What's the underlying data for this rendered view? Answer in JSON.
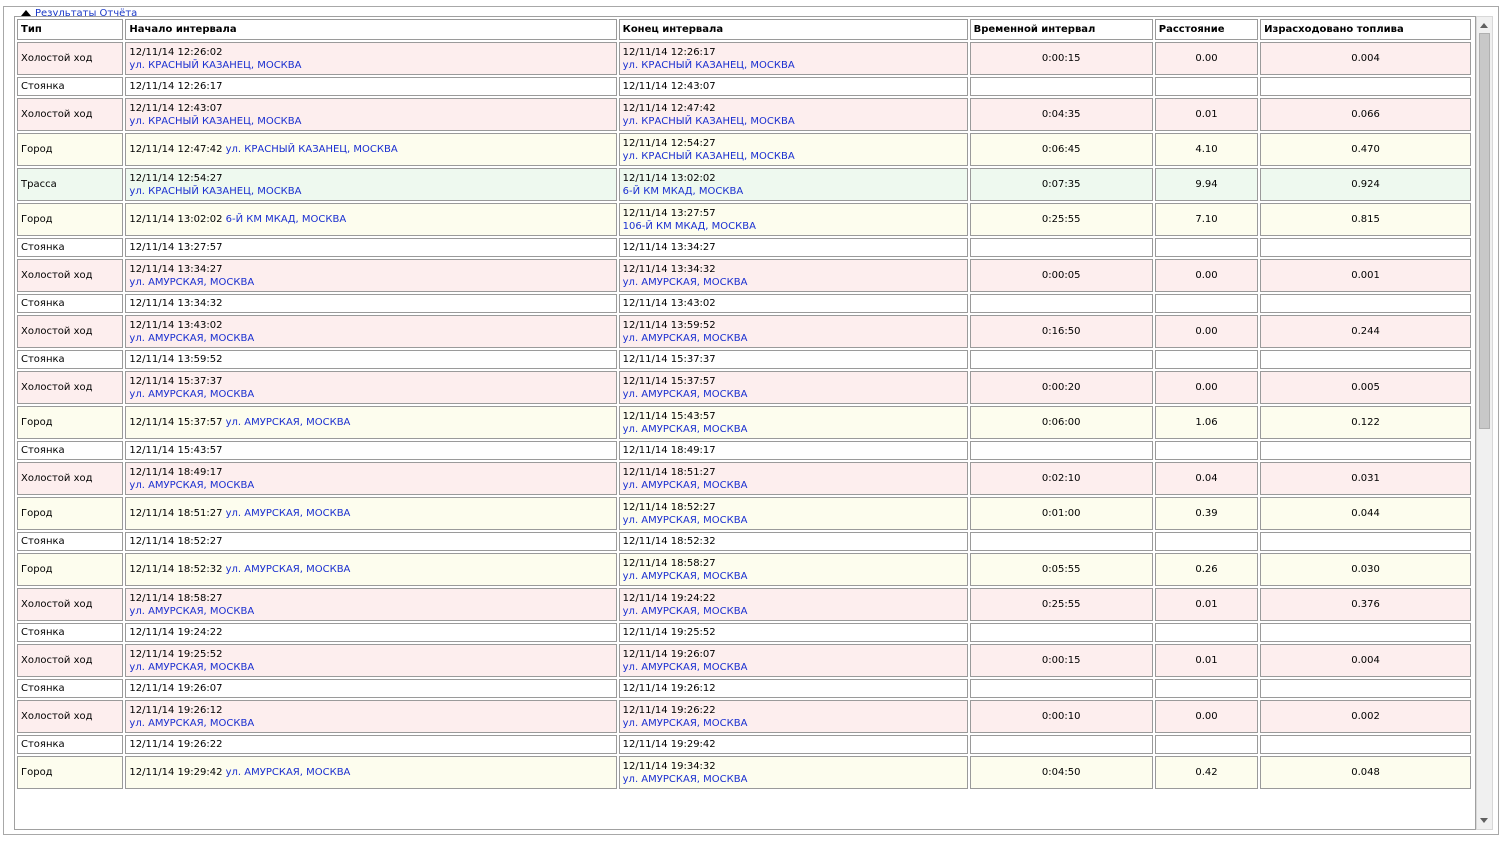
{
  "panel": {
    "title": "Результаты Отчёта"
  },
  "columns": [
    "Тип",
    "Начало интервала",
    "Конец интервала",
    "Временной интервал",
    "Расстояние",
    "Израсходовано топлива"
  ],
  "rows": [
    {
      "kind": "idle",
      "type": "Холостой ход",
      "start_time": "12/11/14 12:26:02",
      "start_addr": "ул. КРАСНЫЙ КАЗАНЕЦ, МОСКВА",
      "start_inline": false,
      "end_time": "12/11/14 12:26:17",
      "end_addr": "ул. КРАСНЫЙ КАЗАНЕЦ, МОСКВА",
      "duration": "0:00:15",
      "distance": "0.00",
      "fuel": "0.004"
    },
    {
      "kind": "parking",
      "type": "Стоянка",
      "start_time": "12/11/14 12:26:17",
      "start_addr": "",
      "start_inline": false,
      "end_time": "12/11/14 12:43:07",
      "end_addr": "",
      "duration": "",
      "distance": "",
      "fuel": ""
    },
    {
      "kind": "idle",
      "type": "Холостой ход",
      "start_time": "12/11/14 12:43:07",
      "start_addr": "ул. КРАСНЫЙ КАЗАНЕЦ, МОСКВА",
      "start_inline": false,
      "end_time": "12/11/14 12:47:42",
      "end_addr": "ул. КРАСНЫЙ КАЗАНЕЦ, МОСКВА",
      "duration": "0:04:35",
      "distance": "0.01",
      "fuel": "0.066"
    },
    {
      "kind": "city",
      "type": "Город",
      "start_time": "12/11/14 12:47:42",
      "start_addr": "ул. КРАСНЫЙ КАЗАНЕЦ, МОСКВА",
      "start_inline": true,
      "end_time": "12/11/14 12:54:27",
      "end_addr": "ул. КРАСНЫЙ КАЗАНЕЦ, МОСКВА",
      "duration": "0:06:45",
      "distance": "4.10",
      "fuel": "0.470"
    },
    {
      "kind": "highway",
      "type": "Трасса",
      "start_time": "12/11/14 12:54:27",
      "start_addr": "ул. КРАСНЫЙ КАЗАНЕЦ, МОСКВА",
      "start_inline": false,
      "end_time": "12/11/14 13:02:02",
      "end_addr": "6-Й КМ МКАД, МОСКВА",
      "duration": "0:07:35",
      "distance": "9.94",
      "fuel": "0.924"
    },
    {
      "kind": "city",
      "type": "Город",
      "start_time": "12/11/14 13:02:02",
      "start_addr": "6-Й КМ МКАД, МОСКВА",
      "start_inline": true,
      "end_time": "12/11/14 13:27:57",
      "end_addr": "106-Й КМ МКАД, МОСКВА",
      "duration": "0:25:55",
      "distance": "7.10",
      "fuel": "0.815"
    },
    {
      "kind": "parking",
      "type": "Стоянка",
      "start_time": "12/11/14 13:27:57",
      "start_addr": "",
      "start_inline": false,
      "end_time": "12/11/14 13:34:27",
      "end_addr": "",
      "duration": "",
      "distance": "",
      "fuel": ""
    },
    {
      "kind": "idle",
      "type": "Холостой ход",
      "start_time": "12/11/14 13:34:27",
      "start_addr": "ул. АМУРСКАЯ, МОСКВА",
      "start_inline": false,
      "end_time": "12/11/14 13:34:32",
      "end_addr": "ул. АМУРСКАЯ, МОСКВА",
      "duration": "0:00:05",
      "distance": "0.00",
      "fuel": "0.001"
    },
    {
      "kind": "parking",
      "type": "Стоянка",
      "start_time": "12/11/14 13:34:32",
      "start_addr": "",
      "start_inline": false,
      "end_time": "12/11/14 13:43:02",
      "end_addr": "",
      "duration": "",
      "distance": "",
      "fuel": ""
    },
    {
      "kind": "idle",
      "type": "Холостой ход",
      "start_time": "12/11/14 13:43:02",
      "start_addr": "ул. АМУРСКАЯ, МОСКВА",
      "start_inline": false,
      "end_time": "12/11/14 13:59:52",
      "end_addr": "ул. АМУРСКАЯ, МОСКВА",
      "duration": "0:16:50",
      "distance": "0.00",
      "fuel": "0.244"
    },
    {
      "kind": "parking",
      "type": "Стоянка",
      "start_time": "12/11/14 13:59:52",
      "start_addr": "",
      "start_inline": false,
      "end_time": "12/11/14 15:37:37",
      "end_addr": "",
      "duration": "",
      "distance": "",
      "fuel": ""
    },
    {
      "kind": "idle",
      "type": "Холостой ход",
      "start_time": "12/11/14 15:37:37",
      "start_addr": "ул. АМУРСКАЯ, МОСКВА",
      "start_inline": false,
      "end_time": "12/11/14 15:37:57",
      "end_addr": "ул. АМУРСКАЯ, МОСКВА",
      "duration": "0:00:20",
      "distance": "0.00",
      "fuel": "0.005"
    },
    {
      "kind": "city",
      "type": "Город",
      "start_time": "12/11/14 15:37:57",
      "start_addr": "ул. АМУРСКАЯ, МОСКВА",
      "start_inline": true,
      "end_time": "12/11/14 15:43:57",
      "end_addr": "ул. АМУРСКАЯ, МОСКВА",
      "duration": "0:06:00",
      "distance": "1.06",
      "fuel": "0.122"
    },
    {
      "kind": "parking",
      "type": "Стоянка",
      "start_time": "12/11/14 15:43:57",
      "start_addr": "",
      "start_inline": false,
      "end_time": "12/11/14 18:49:17",
      "end_addr": "",
      "duration": "",
      "distance": "",
      "fuel": ""
    },
    {
      "kind": "idle",
      "type": "Холостой ход",
      "start_time": "12/11/14 18:49:17",
      "start_addr": "ул. АМУРСКАЯ, МОСКВА",
      "start_inline": false,
      "end_time": "12/11/14 18:51:27",
      "end_addr": "ул. АМУРСКАЯ, МОСКВА",
      "duration": "0:02:10",
      "distance": "0.04",
      "fuel": "0.031"
    },
    {
      "kind": "city",
      "type": "Город",
      "start_time": "12/11/14 18:51:27",
      "start_addr": "ул. АМУРСКАЯ, МОСКВА",
      "start_inline": true,
      "end_time": "12/11/14 18:52:27",
      "end_addr": "ул. АМУРСКАЯ, МОСКВА",
      "duration": "0:01:00",
      "distance": "0.39",
      "fuel": "0.044"
    },
    {
      "kind": "parking",
      "type": "Стоянка",
      "start_time": "12/11/14 18:52:27",
      "start_addr": "",
      "start_inline": false,
      "end_time": "12/11/14 18:52:32",
      "end_addr": "",
      "duration": "",
      "distance": "",
      "fuel": ""
    },
    {
      "kind": "city",
      "type": "Город",
      "start_time": "12/11/14 18:52:32",
      "start_addr": "ул. АМУРСКАЯ, МОСКВА",
      "start_inline": true,
      "end_time": "12/11/14 18:58:27",
      "end_addr": "ул. АМУРСКАЯ, МОСКВА",
      "duration": "0:05:55",
      "distance": "0.26",
      "fuel": "0.030"
    },
    {
      "kind": "idle",
      "type": "Холостой ход",
      "start_time": "12/11/14 18:58:27",
      "start_addr": "ул. АМУРСКАЯ, МОСКВА",
      "start_inline": false,
      "end_time": "12/11/14 19:24:22",
      "end_addr": "ул. АМУРСКАЯ, МОСКВА",
      "duration": "0:25:55",
      "distance": "0.01",
      "fuel": "0.376"
    },
    {
      "kind": "parking",
      "type": "Стоянка",
      "start_time": "12/11/14 19:24:22",
      "start_addr": "",
      "start_inline": false,
      "end_time": "12/11/14 19:25:52",
      "end_addr": "",
      "duration": "",
      "distance": "",
      "fuel": ""
    },
    {
      "kind": "idle",
      "type": "Холостой ход",
      "start_time": "12/11/14 19:25:52",
      "start_addr": "ул. АМУРСКАЯ, МОСКВА",
      "start_inline": false,
      "end_time": "12/11/14 19:26:07",
      "end_addr": "ул. АМУРСКАЯ, МОСКВА",
      "duration": "0:00:15",
      "distance": "0.01",
      "fuel": "0.004"
    },
    {
      "kind": "parking",
      "type": "Стоянка",
      "start_time": "12/11/14 19:26:07",
      "start_addr": "",
      "start_inline": false,
      "end_time": "12/11/14 19:26:12",
      "end_addr": "",
      "duration": "",
      "distance": "",
      "fuel": ""
    },
    {
      "kind": "idle",
      "type": "Холостой ход",
      "start_time": "12/11/14 19:26:12",
      "start_addr": "ул. АМУРСКАЯ, МОСКВА",
      "start_inline": false,
      "end_time": "12/11/14 19:26:22",
      "end_addr": "ул. АМУРСКАЯ, МОСКВА",
      "duration": "0:00:10",
      "distance": "0.00",
      "fuel": "0.002"
    },
    {
      "kind": "parking",
      "type": "Стоянка",
      "start_time": "12/11/14 19:26:22",
      "start_addr": "",
      "start_inline": false,
      "end_time": "12/11/14 19:29:42",
      "end_addr": "",
      "duration": "",
      "distance": "",
      "fuel": ""
    },
    {
      "kind": "city",
      "type": "Город",
      "start_time": "12/11/14 19:29:42",
      "start_addr": "ул. АМУРСКАЯ, МОСКВА",
      "start_inline": true,
      "end_time": "12/11/14 19:34:32",
      "end_addr": "ул. АМУРСКАЯ, МОСКВА",
      "duration": "0:04:50",
      "distance": "0.42",
      "fuel": "0.048"
    }
  ],
  "colors": {
    "idle": "#fdeeee",
    "parking": "#ffffff",
    "city": "#fdfdee",
    "highway": "#eef9ef",
    "address_link": "#1a2fd0"
  },
  "icons": {
    "collapse": "triangle-up-icon",
    "scroll_up": "chevron-up-icon",
    "scroll_down": "chevron-down-icon"
  }
}
